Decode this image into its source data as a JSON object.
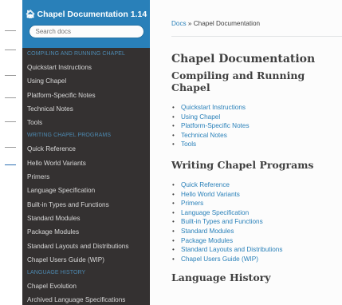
{
  "sidebar": {
    "brand": "Chapel Documentation 1.14",
    "search_placeholder": "Search docs",
    "sections": [
      {
        "caption": "COMPILING AND RUNNING CHAPEL",
        "items": [
          "Quickstart Instructions",
          "Using Chapel",
          "Platform-Specific Notes",
          "Technical Notes",
          "Tools"
        ]
      },
      {
        "caption": "WRITING CHAPEL PROGRAMS",
        "items": [
          "Quick Reference",
          "Hello World Variants",
          "Primers",
          "Language Specification",
          "Built-in Types and Functions",
          "Standard Modules",
          "Package Modules",
          "Standard Layouts and Distributions",
          "Chapel Users Guide (WIP)"
        ]
      },
      {
        "caption": "LANGUAGE HISTORY",
        "items": [
          "Chapel Evolution",
          "Archived Language Specifications"
        ]
      }
    ]
  },
  "breadcrumb": {
    "root": "Docs",
    "separator": " » ",
    "current": "Chapel Documentation"
  },
  "main": {
    "title": "Chapel Documentation",
    "sections": [
      {
        "heading": "Compiling and Running Chapel",
        "links": [
          "Quickstart Instructions",
          "Using Chapel",
          "Platform-Specific Notes",
          "Technical Notes",
          "Tools"
        ]
      },
      {
        "heading": "Writing Chapel Programs",
        "links": [
          "Quick Reference",
          "Hello World Variants",
          "Primers",
          "Language Specification",
          "Built-in Types and Functions",
          "Standard Modules",
          "Package Modules",
          "Standard Layouts and Distributions",
          "Chapel Users Guide (WIP)"
        ]
      },
      {
        "heading": "Language History",
        "links": []
      }
    ]
  },
  "colors": {
    "accent": "#2980b9",
    "sidebar_bg": "#343131",
    "caption": "#55a5d9",
    "text": "#404040"
  }
}
